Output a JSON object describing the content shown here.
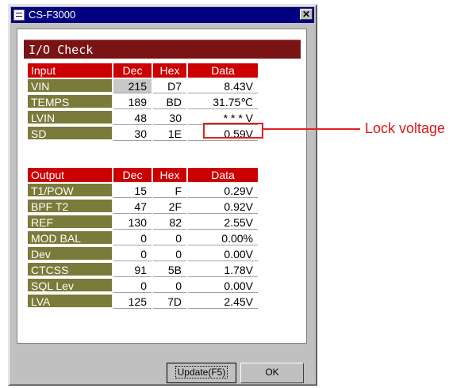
{
  "window": {
    "title": "CS-F3000",
    "close_glyph": "✕"
  },
  "panel": {
    "title": "I/O Check"
  },
  "input_table": {
    "headers": {
      "name": "Input",
      "dec": "Dec",
      "hex": "Hex",
      "data": "Data"
    },
    "rows": [
      {
        "name": "VIN",
        "dec": "215",
        "hex": "D7",
        "data": "8.43V"
      },
      {
        "name": "TEMPS",
        "dec": "189",
        "hex": "BD",
        "data": "31.75℃"
      },
      {
        "name": "LVIN",
        "dec": "48",
        "hex": "30",
        "data": "* * * V"
      },
      {
        "name": "SD",
        "dec": "30",
        "hex": "1E",
        "data": "0.59V"
      }
    ]
  },
  "output_table": {
    "headers": {
      "name": "Output",
      "dec": "Dec",
      "hex": "Hex",
      "data": "Data"
    },
    "rows": [
      {
        "name": "T1/POW",
        "dec": "15",
        "hex": "F",
        "data": "0.29V"
      },
      {
        "name": "BPF T2",
        "dec": "47",
        "hex": "2F",
        "data": "0.92V"
      },
      {
        "name": "REF",
        "dec": "130",
        "hex": "82",
        "data": "2.55V"
      },
      {
        "name": "MOD BAL",
        "dec": "0",
        "hex": "0",
        "data": "0.00%"
      },
      {
        "name": "Dev",
        "dec": "0",
        "hex": "0",
        "data": "0.00V"
      },
      {
        "name": "CTCSS",
        "dec": "91",
        "hex": "5B",
        "data": "1.78V"
      },
      {
        "name": "SQL Lev",
        "dec": "0",
        "hex": "0",
        "data": "0.00V"
      },
      {
        "name": "LVA",
        "dec": "125",
        "hex": "7D",
        "data": "2.45V"
      }
    ]
  },
  "buttons": {
    "update": "Update(F5)",
    "ok": "OK"
  },
  "annotation": {
    "label": "Lock voltage",
    "color": "#e02020"
  },
  "colors": {
    "header_bg": "#7a1414",
    "column_header_bg": "#cc0000",
    "name_cell_bg": "#7a7a3a",
    "title_bar": "#000080"
  },
  "icons": {
    "app": "app-window-icon",
    "close": "close-icon"
  }
}
